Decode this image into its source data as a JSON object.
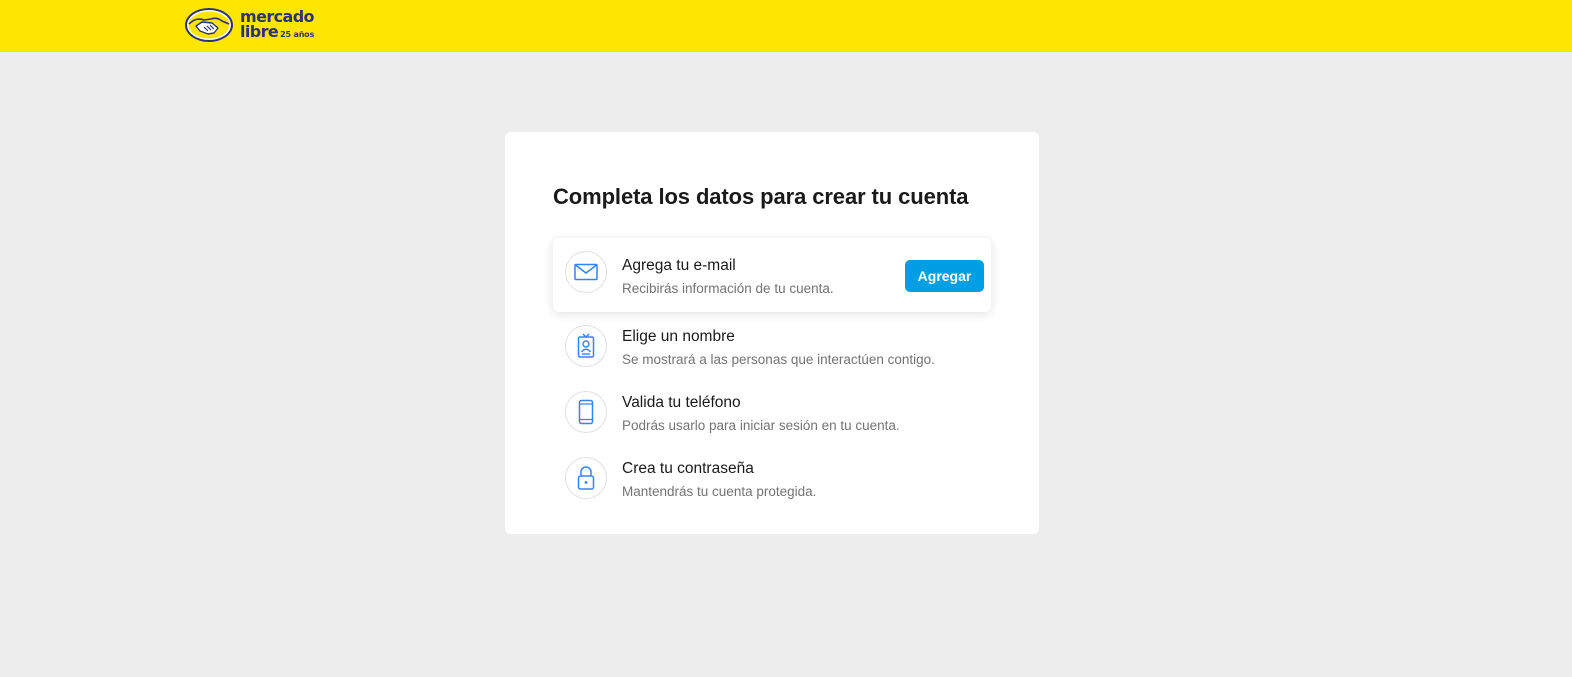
{
  "brand": {
    "line1": "mercado",
    "line2": "libre",
    "anniversary": "25 años",
    "colors": {
      "header": "#ffe600",
      "logo_text": "#2d3277",
      "accent": "#009ee3"
    }
  },
  "card": {
    "title": "Completa los datos para crear tu cuenta",
    "steps": [
      {
        "icon": "envelope-icon",
        "title": "Agrega tu e-mail",
        "subtitle": "Recibirás información de tu cuenta.",
        "action_label": "Agregar"
      },
      {
        "icon": "id-badge-icon",
        "title": "Elige un nombre",
        "subtitle": "Se mostrará a las personas que interactúen contigo."
      },
      {
        "icon": "phone-icon",
        "title": "Valida tu teléfono",
        "subtitle": "Podrás usarlo para iniciar sesión en tu cuenta."
      },
      {
        "icon": "lock-icon",
        "title": "Crea tu contraseña",
        "subtitle": "Mantendrás tu cuenta protegida."
      }
    ]
  }
}
